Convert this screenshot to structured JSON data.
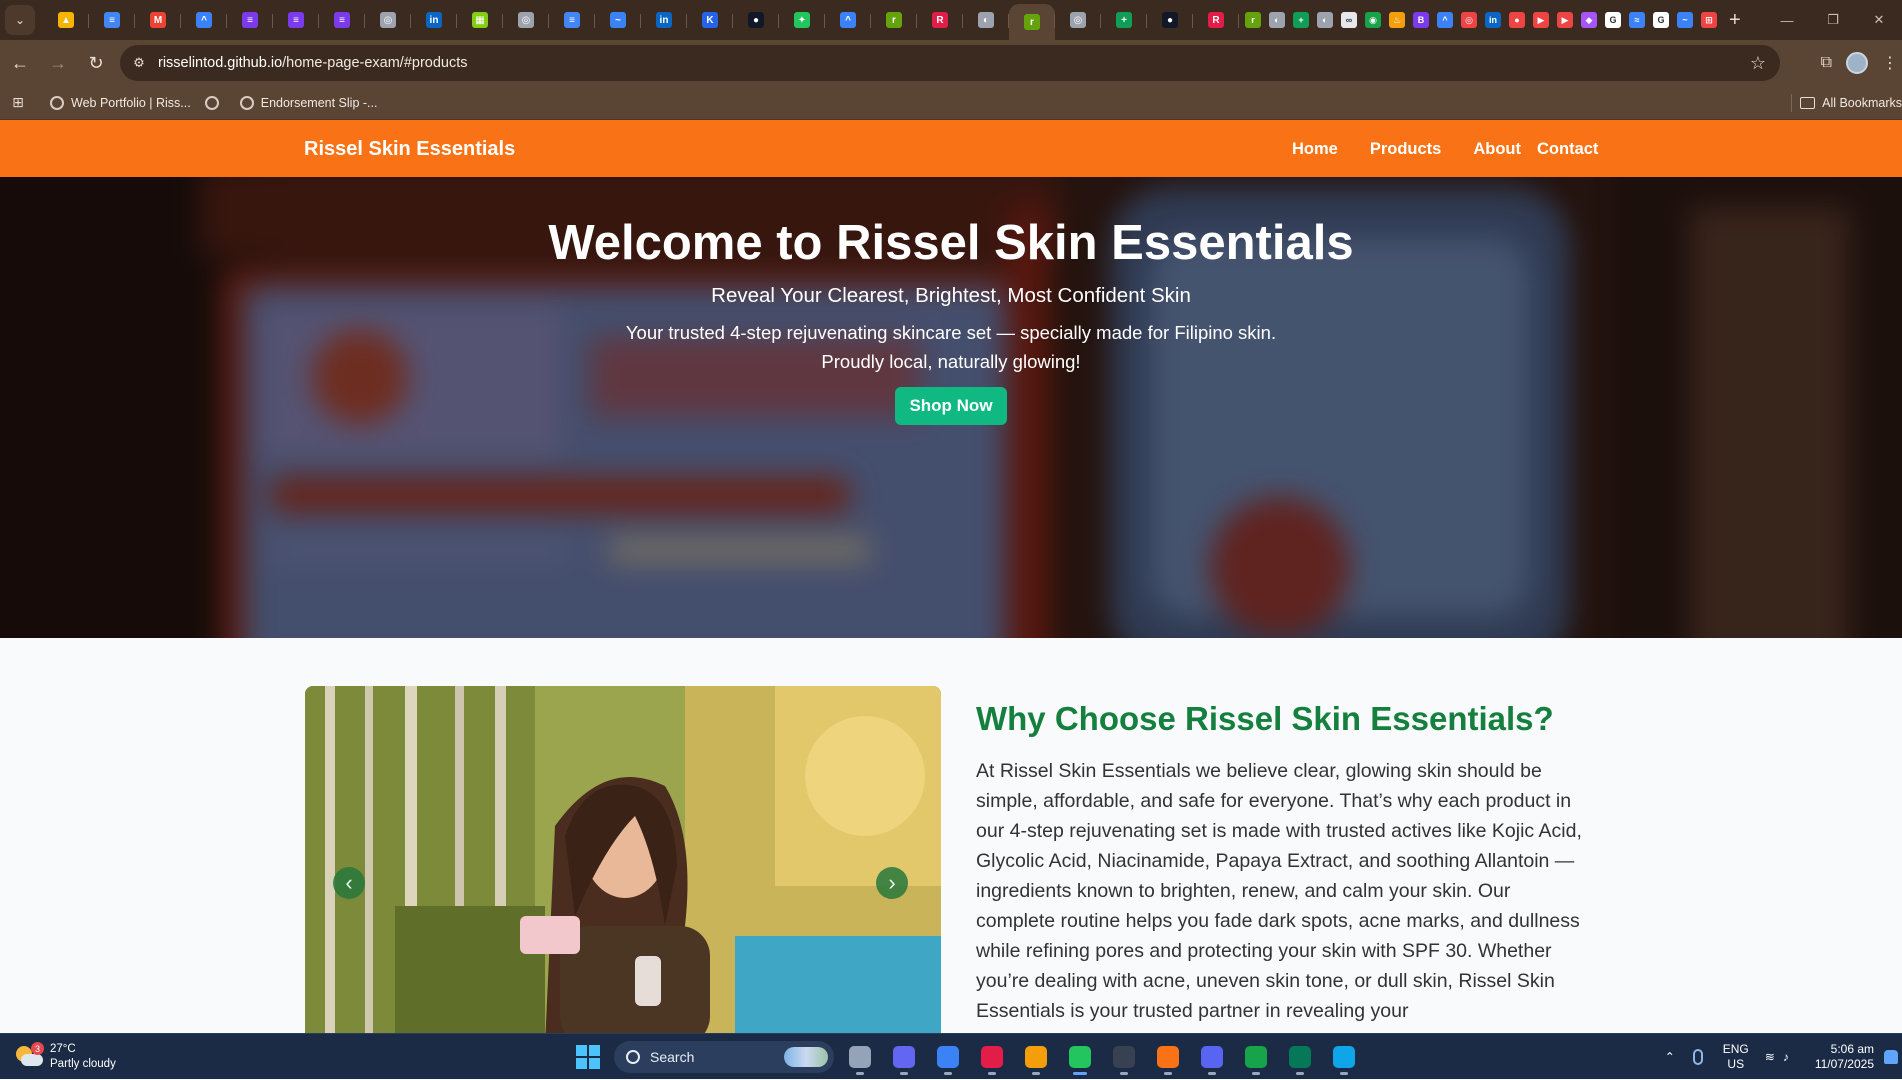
{
  "browser": {
    "tabs": [
      {
        "icon": "google-drive-icon",
        "color": "#f4b400",
        "glyph": "▲"
      },
      {
        "icon": "google-docs-icon",
        "color": "#4285f4",
        "glyph": "≡"
      },
      {
        "icon": "gmail-icon",
        "color": "#ea4335",
        "glyph": "M"
      },
      {
        "icon": "app-icon",
        "color": "#3b82f6",
        "glyph": "^"
      },
      {
        "icon": "google-forms-icon",
        "color": "#7c3aed",
        "glyph": "≡"
      },
      {
        "icon": "google-forms-icon",
        "color": "#7c3aed",
        "glyph": "≡"
      },
      {
        "icon": "google-forms-icon",
        "color": "#7c3aed",
        "glyph": "≡"
      },
      {
        "icon": "target-icon",
        "color": "#9ca3af",
        "glyph": "◎"
      },
      {
        "icon": "linkedin-icon",
        "color": "#0a66c2",
        "glyph": "in"
      },
      {
        "icon": "image-icon",
        "color": "#84cc16",
        "glyph": "▦"
      },
      {
        "icon": "target-icon",
        "color": "#9ca3af",
        "glyph": "◎"
      },
      {
        "icon": "google-docs-icon",
        "color": "#4285f4",
        "glyph": "≡"
      },
      {
        "icon": "messenger-icon",
        "color": "#3b82f6",
        "glyph": "~"
      },
      {
        "icon": "linkedin-icon",
        "color": "#0a66c2",
        "glyph": "in"
      },
      {
        "icon": "k-icon",
        "color": "#2563eb",
        "glyph": "K"
      },
      {
        "icon": "github-icon",
        "color": "#111827",
        "glyph": "●"
      },
      {
        "icon": "puzzle-icon",
        "color": "#22c55e",
        "glyph": "✦"
      },
      {
        "icon": "app-icon",
        "color": "#3b82f6",
        "glyph": "^"
      },
      {
        "icon": "rse-icon",
        "color": "#65a30d",
        "glyph": "r"
      },
      {
        "icon": "r-logo-icon",
        "color": "#e11d48",
        "glyph": "R"
      },
      {
        "icon": "globe-icon",
        "color": "#9ca3af",
        "glyph": "◐"
      },
      {
        "icon": "rse-icon",
        "color": "#65a30d",
        "glyph": "r",
        "active": true
      },
      {
        "icon": "target-icon",
        "color": "#9ca3af",
        "glyph": "◎"
      },
      {
        "icon": "google-sheets-icon",
        "color": "#0f9d58",
        "glyph": "+"
      },
      {
        "icon": "github-icon",
        "color": "#111827",
        "glyph": "●"
      },
      {
        "icon": "r-logo-icon",
        "color": "#e11d48",
        "glyph": "R"
      }
    ],
    "small_tabs": [
      {
        "icon": "rse-icon",
        "color": "#65a30d",
        "glyph": "r"
      },
      {
        "icon": "globe-icon",
        "color": "#9ca3af",
        "glyph": "◐"
      },
      {
        "icon": "google-sheets-icon",
        "color": "#0f9d58",
        "glyph": "+"
      },
      {
        "icon": "globe-icon",
        "color": "#9ca3af",
        "glyph": "◐"
      },
      {
        "icon": "link-icon",
        "color": "#e5e7eb",
        "glyph": "∞"
      },
      {
        "icon": "map-pin-icon",
        "color": "#16a34a",
        "glyph": "◉"
      },
      {
        "icon": "cake-icon",
        "color": "#f59e0b",
        "glyph": "♨"
      },
      {
        "icon": "bootstrap-icon",
        "color": "#7c3aed",
        "glyph": "B"
      },
      {
        "icon": "app-icon",
        "color": "#3b82f6",
        "glyph": "^"
      },
      {
        "icon": "target-icon",
        "color": "#ef4444",
        "glyph": "◎"
      },
      {
        "icon": "linkedin-icon",
        "color": "#0a66c2",
        "glyph": "in"
      },
      {
        "icon": "circle-icon",
        "color": "#ef4444",
        "glyph": "●"
      },
      {
        "icon": "youtube-icon",
        "color": "#ef4444",
        "glyph": "▶"
      },
      {
        "icon": "youtube-icon",
        "color": "#ef4444",
        "glyph": "▶"
      },
      {
        "icon": "twitch-icon",
        "color": "#a855f7",
        "glyph": "◆"
      },
      {
        "icon": "google-icon",
        "color": "#ffffff",
        "glyph": "G"
      },
      {
        "icon": "wave-icon",
        "color": "#3b82f6",
        "glyph": "≈"
      },
      {
        "icon": "google-icon",
        "color": "#ffffff",
        "glyph": "G"
      },
      {
        "icon": "messenger-icon",
        "color": "#3b82f6",
        "glyph": "~"
      },
      {
        "icon": "cart-icon",
        "color": "#ef4444",
        "glyph": "⊞"
      }
    ],
    "url_host": "risselintod.github.io",
    "url_path": "/home-page-exam/#products",
    "bookmarks": [
      {
        "label": "Web Portfolio | Riss..."
      },
      {
        "label": ""
      },
      {
        "label": "Endorsement Slip -..."
      }
    ],
    "all_bookmarks": "All Bookmarks"
  },
  "site": {
    "brand": "Rissel Skin Essentials",
    "nav": {
      "home": "Home",
      "products": "Products",
      "about": "About",
      "contact": "Contact"
    },
    "hero": {
      "title": "Welcome to Rissel Skin Essentials",
      "subtitle": "Reveal Your Clearest, Brightest, Most Confident Skin",
      "desc_line1": "Your trusted 4-step rejuvenating skincare set — specially made for Filipino skin.",
      "desc_line2": "Proudly local, naturally glowing!",
      "cta": "Shop Now"
    },
    "why": {
      "title": "Why Choose Rissel Skin Essentials?",
      "body": "At Rissel Skin Essentials we believe clear, glowing skin should be simple, affordable, and safe for everyone. That’s why each product in our 4-step rejuvenating set is made with trusted actives like Kojic Acid, Glycolic Acid, Niacinamide, Papaya Extract, and soothing Allantoin — ingredients known to brighten, renew, and calm your skin. Our complete routine helps you fade dark spots, acne marks, and dullness while refining pores and protecting your skin with SPF 30. Whether you’re dealing with acne, uneven skin tone, or dull skin, Rissel Skin Essentials is your trusted partner in revealing your"
    },
    "carousel": {
      "prev": "‹",
      "next": "›"
    }
  },
  "taskbar": {
    "weather_temp": "27°C",
    "weather_desc": "Partly cloudy",
    "weather_badge": "3",
    "search": "Search",
    "lang1": "ENG",
    "lang2": "US",
    "time": "5:06 am",
    "date": "11/07/2025",
    "apps": [
      {
        "name": "task-view-icon",
        "color": "#94a3b8"
      },
      {
        "name": "meet-icon",
        "color": "#6366f1"
      },
      {
        "name": "notepad-icon",
        "color": "#3b82f6"
      },
      {
        "name": "snipping-tool-icon",
        "color": "#e11d48"
      },
      {
        "name": "file-explorer-icon",
        "color": "#f59e0b"
      },
      {
        "name": "chrome-icon",
        "color": "#22c55e",
        "active": true
      },
      {
        "name": "terminal-icon",
        "color": "#374151"
      },
      {
        "name": "postman-icon",
        "color": "#f97316"
      },
      {
        "name": "discord-icon",
        "color": "#5865f2"
      },
      {
        "name": "mongodb-compass-icon",
        "color": "#16a34a"
      },
      {
        "name": "mongodb-icon",
        "color": "#047857"
      },
      {
        "name": "vscode-icon",
        "color": "#0ea5e9"
      }
    ]
  }
}
